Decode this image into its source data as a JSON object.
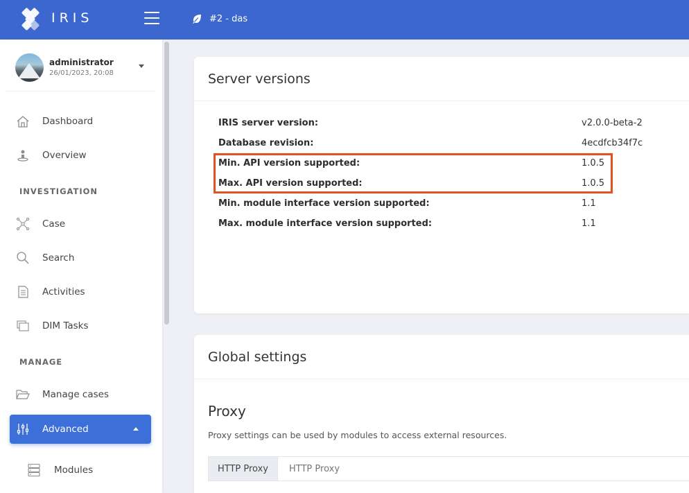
{
  "header": {
    "logo_text": "IRIS",
    "case_label": "#2 - das"
  },
  "user": {
    "name": "administrator",
    "datetime": "26/01/2023, 20:08"
  },
  "nav": {
    "dashboard": "Dashboard",
    "overview": "Overview",
    "section_investigation": "INVESTIGATION",
    "case": "Case",
    "search": "Search",
    "activities": "Activities",
    "dim_tasks": "DIM Tasks",
    "section_manage": "MANAGE",
    "manage_cases": "Manage cases",
    "advanced": "Advanced",
    "modules": "Modules"
  },
  "server_versions": {
    "title": "Server versions",
    "rows": [
      {
        "label": "IRIS server version:",
        "value": "v2.0.0-beta-2"
      },
      {
        "label": "Database revision:",
        "value": "4ecdfcb34f7c"
      },
      {
        "label": "Min. API version supported:",
        "value": "1.0.5"
      },
      {
        "label": "Max. API version supported:",
        "value": "1.0.5"
      },
      {
        "label": "Min. module interface version supported:",
        "value": "1.1"
      },
      {
        "label": "Max. module interface version supported:",
        "value": "1.1"
      }
    ]
  },
  "global_settings": {
    "title": "Global settings",
    "proxy_title": "Proxy",
    "proxy_description": "Proxy settings can be used by modules to access external resources.",
    "http_proxy_label": "HTTP Proxy",
    "http_proxy_placeholder": "HTTP Proxy"
  },
  "colors": {
    "topbar": "#3b67ce",
    "active_nav": "#3d6fd9",
    "highlight_border": "#e0521f"
  }
}
